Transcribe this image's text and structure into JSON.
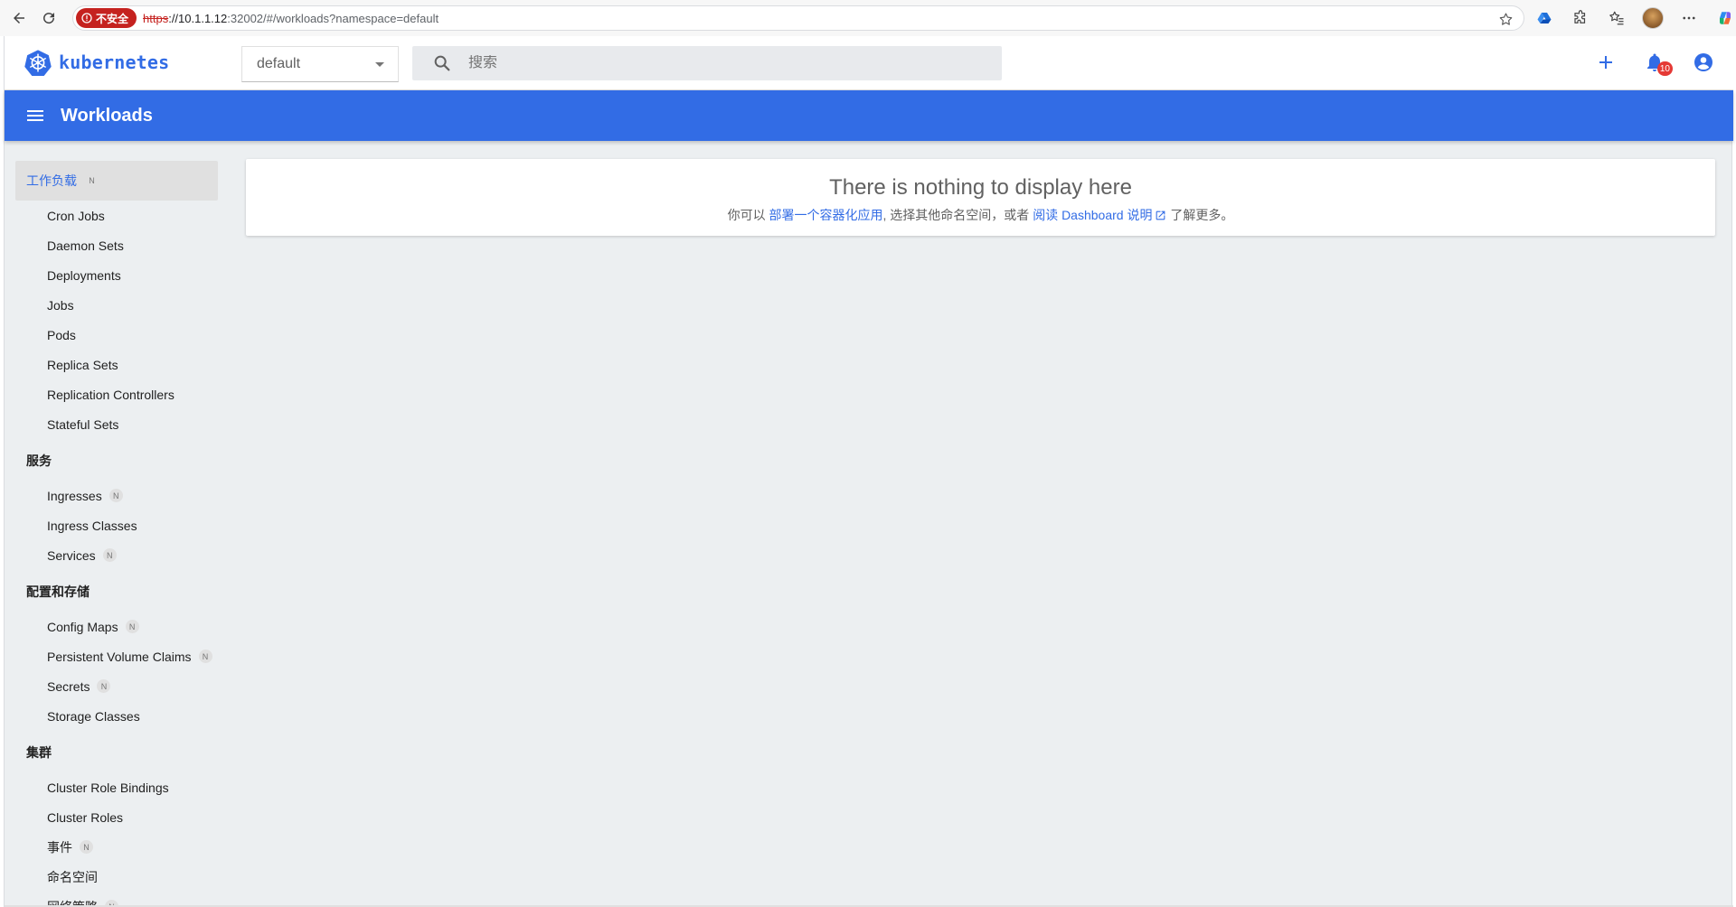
{
  "browser": {
    "security_label": "不安全",
    "url_scheme": "https",
    "url_host": "://10.1.1.12",
    "url_rest": ":32002/#/workloads?namespace=default"
  },
  "app": {
    "brand": "kubernetes",
    "namespace": "default",
    "search_placeholder": "搜索",
    "notification_count": "10",
    "page_title": "Workloads"
  },
  "sidebar": {
    "groups": [
      {
        "label": "工作负载",
        "namespaced": true,
        "active": true,
        "items": [
          {
            "label": "Cron Jobs",
            "namespaced": false
          },
          {
            "label": "Daemon Sets",
            "namespaced": false
          },
          {
            "label": "Deployments",
            "namespaced": false
          },
          {
            "label": "Jobs",
            "namespaced": false
          },
          {
            "label": "Pods",
            "namespaced": false
          },
          {
            "label": "Replica Sets",
            "namespaced": false
          },
          {
            "label": "Replication Controllers",
            "namespaced": false
          },
          {
            "label": "Stateful Sets",
            "namespaced": false
          }
        ]
      },
      {
        "label": "服务",
        "namespaced": false,
        "active": false,
        "items": [
          {
            "label": "Ingresses",
            "namespaced": true
          },
          {
            "label": "Ingress Classes",
            "namespaced": false
          },
          {
            "label": "Services",
            "namespaced": true
          }
        ]
      },
      {
        "label": "配置和存储",
        "namespaced": false,
        "active": false,
        "items": [
          {
            "label": "Config Maps",
            "namespaced": true
          },
          {
            "label": "Persistent Volume Claims",
            "namespaced": true
          },
          {
            "label": "Secrets",
            "namespaced": true
          },
          {
            "label": "Storage Classes",
            "namespaced": false
          }
        ]
      },
      {
        "label": "集群",
        "namespaced": false,
        "active": false,
        "items": [
          {
            "label": "Cluster Role Bindings",
            "namespaced": false
          },
          {
            "label": "Cluster Roles",
            "namespaced": false
          },
          {
            "label": "事件",
            "namespaced": true
          },
          {
            "label": "命名空间",
            "namespaced": false
          },
          {
            "label": "网络策略",
            "namespaced": true
          }
        ]
      }
    ],
    "namespaced_badge": "N"
  },
  "empty_state": {
    "title": "There is nothing to display here",
    "prefix": "你可以",
    "deploy_link": "部署一个容器化应用",
    "middle": ", 选择其他命名空间，或者",
    "docs_link": "阅读 Dashboard 说明",
    "suffix": "了解更多。"
  },
  "colors": {
    "brand": "#326ce5",
    "insecure": "#c5221f",
    "badge": "#e53935"
  }
}
